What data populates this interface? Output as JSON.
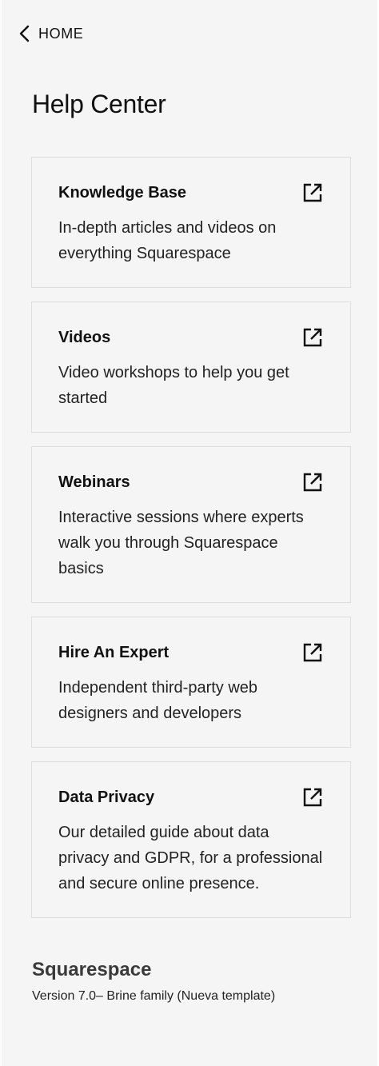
{
  "nav": {
    "back_label": "HOME",
    "back_icon": "chevron-left-icon"
  },
  "page": {
    "title": "Help Center"
  },
  "cards": [
    {
      "title": "Knowledge Base",
      "description": "In-depth articles and videos on everything Squarespace",
      "icon": "external-link-icon"
    },
    {
      "title": "Videos",
      "description": "Video workshops to help you get started",
      "icon": "external-link-icon"
    },
    {
      "title": "Webinars",
      "description": "Interactive sessions where experts walk you through Squarespace basics",
      "icon": "external-link-icon"
    },
    {
      "title": "Hire An Expert",
      "description": "Independent third-party web designers and developers",
      "icon": "external-link-icon"
    },
    {
      "title": "Data Privacy",
      "description": "Our detailed guide about data privacy and GDPR, for a professional and secure online presence.",
      "icon": "external-link-icon"
    }
  ],
  "footer": {
    "brand": "Squarespace",
    "version": "Version 7.0– Brine family (Nueva template)"
  },
  "colors": {
    "panel_background": "#f5f5f5",
    "card_border": "#dedede",
    "text": "#111111"
  }
}
